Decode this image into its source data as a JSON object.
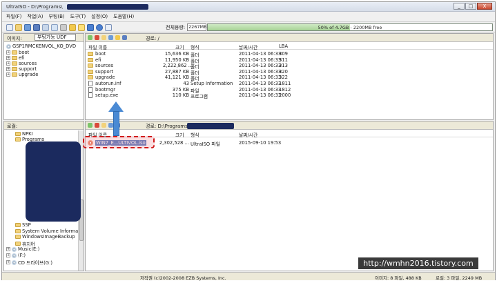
{
  "window": {
    "title": "UltraISO - D:\\Programs\\",
    "controls": [
      "_",
      "□",
      "X"
    ]
  },
  "menu": [
    "파일(F)",
    "작업(A)",
    "부팅(B)",
    "도구(T)",
    "설정(O)",
    "도움말(H)"
  ],
  "toolbar": {
    "capacity_label": "전체용량:",
    "capacity_value": "2267MB",
    "capacity_text": "50% of 4.7GB - 2200MB free",
    "capacity_fraction": 0.5
  },
  "iso_pane": {
    "image_label": "이미지:",
    "image_type": "부팅가능 UDF",
    "path_label": "경로: /",
    "tree_root": "GSP1RMCKENVOL_KO_DVD",
    "tree_items": [
      "boot",
      "efi",
      "sources",
      "support",
      "upgrade"
    ],
    "columns": [
      "파일 이름",
      "크기",
      "형식",
      "날짜/시간",
      "LBA"
    ],
    "files": [
      {
        "name": "boot",
        "size": "15,636 KB",
        "type": "폴더",
        "date": "2011-04-13 06:33",
        "lba": "309"
      },
      {
        "name": "efi",
        "size": "11,950 KB",
        "type": "폴더",
        "date": "2011-04-13 06:33",
        "lba": "311"
      },
      {
        "name": "sources",
        "size": "2,222,862 ...",
        "type": "폴더",
        "date": "2011-04-13 06:33",
        "lba": "313"
      },
      {
        "name": "support",
        "size": "27,887 KB",
        "type": "폴더",
        "date": "2011-04-13 06:33",
        "lba": "320"
      },
      {
        "name": "upgrade",
        "size": "41,121 KB",
        "type": "폴더",
        "date": "2011-04-13 06:33",
        "lba": "322"
      },
      {
        "name": "autorun.inf",
        "size": "43",
        "type": "Setup Information",
        "date": "2011-04-13 06:33",
        "lba": "1811"
      },
      {
        "name": "bootmgr",
        "size": "375 KB",
        "type": "파일",
        "date": "2011-04-13 06:33",
        "lba": "1812"
      },
      {
        "name": "setup.exe",
        "size": "110 KB",
        "type": "프로그램",
        "date": "2011-04-13 06:33",
        "lba": "2000"
      }
    ]
  },
  "local_pane": {
    "tree_label": "로컬:",
    "path_label": "경로: D:\\Programs\\",
    "columns": [
      "파일 이름",
      "크기",
      "형식",
      "날짜/시간"
    ],
    "tree_items": [
      {
        "label": "NPKI",
        "indent": 1
      },
      {
        "label": "Programs",
        "indent": 1
      },
      {
        "label": "SSP",
        "indent": 1
      },
      {
        "label": "System Volume Informa",
        "indent": 1
      },
      {
        "label": "WindowsImageBackup",
        "indent": 1
      },
      {
        "label": "휴지어",
        "indent": 1
      },
      {
        "label": "Music(E:)",
        "indent": 0
      },
      {
        "label": "(F:)",
        "indent": 0
      },
      {
        "label": "CD 드라이브(G:)",
        "indent": 0
      }
    ],
    "files": [
      {
        "name": "WIN7_E...ULTIVOL.iso",
        "size": "2,302,528 ...",
        "type": "UltraISO 파일",
        "date": "2015-09-10 19:53"
      }
    ]
  },
  "status": {
    "copyright": "저작권 (c)2002-2008 EZB Systems, Inc.",
    "image_info": "이미지: 8 파일, 488 KB",
    "local_info": "로컬: 3 파일, 2249 MB"
  },
  "watermark": "http://wmhn2016.tistory.com",
  "colors": {
    "highlight_dash": "#d11a1a",
    "arrow": "#4a8ad4",
    "redaction": "#1b2a5e",
    "capacity_fill": "#a8d497"
  }
}
